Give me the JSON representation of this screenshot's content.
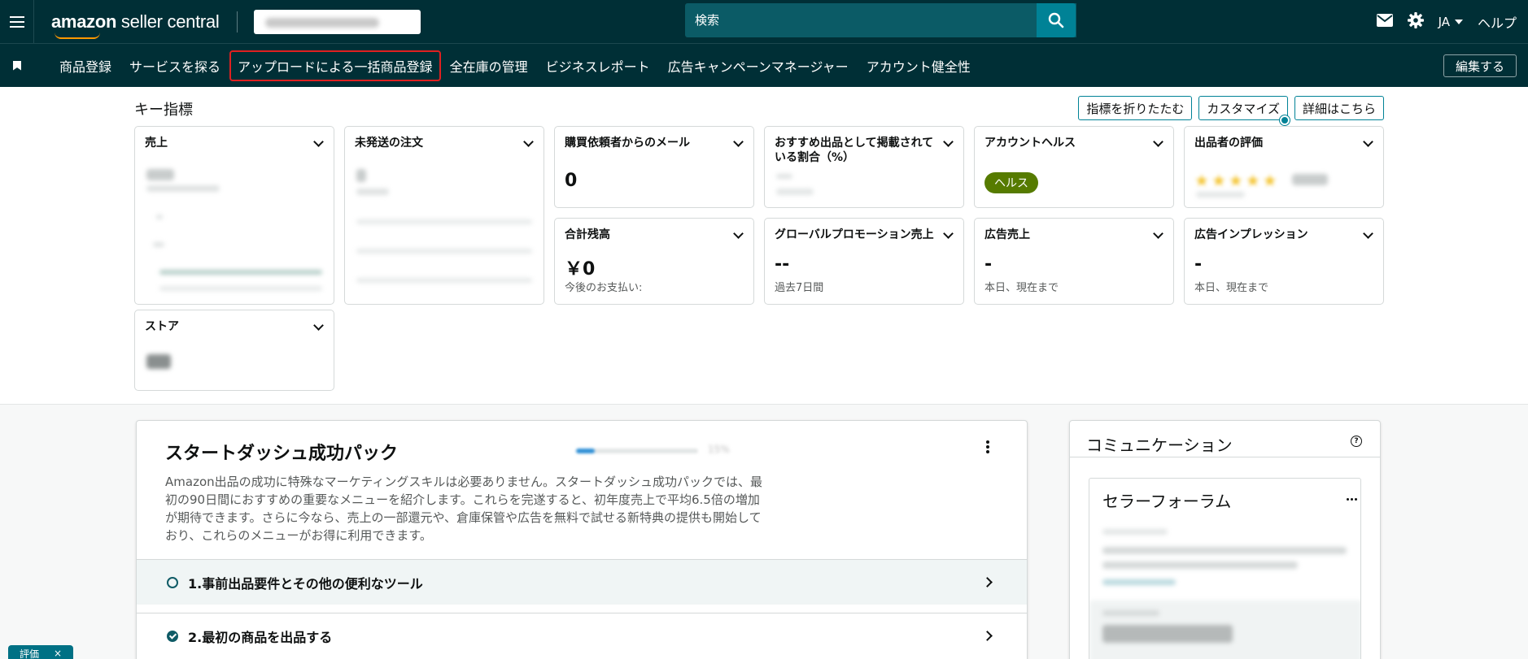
{
  "header": {
    "logo_text_bold": "amazon",
    "logo_text_rest": " seller central",
    "search_placeholder": "検索",
    "lang_label": "JA",
    "help_label": "ヘルプ"
  },
  "nav": {
    "items": [
      {
        "label": "商品登録"
      },
      {
        "label": "サービスを探る"
      },
      {
        "label": "アップロードによる一括商品登録",
        "active": true
      },
      {
        "label": "全在庫の管理"
      },
      {
        "label": "ビジネスレポート"
      },
      {
        "label": "広告キャンペーンマネージャー"
      },
      {
        "label": "アカウント健全性"
      }
    ],
    "edit_label": "編集する"
  },
  "metrics": {
    "title": "キー指標",
    "actions": {
      "collapse": "指標を折りたたむ",
      "customize": "カスタマイズ",
      "details": "詳細はこちら"
    },
    "cards": {
      "sales": {
        "title": "売上"
      },
      "unshipped": {
        "title": "未発送の注文"
      },
      "buyer_messages": {
        "title": "購買依頼者からのメール",
        "value": "0"
      },
      "featured_offer": {
        "title": "おすすめ出品として掲載されている割合（%）"
      },
      "account_health": {
        "title": "アカウントヘルス",
        "badge": "ヘルス"
      },
      "seller_rating": {
        "title": "出品者の評価"
      },
      "total_balance": {
        "title": "合計残高",
        "value": "￥0",
        "sub": "今後のお支払い:"
      },
      "global_promo": {
        "title": "グローバルプロモーション売上",
        "value": "--",
        "sub": "過去7日間"
      },
      "ad_sales": {
        "title": "広告売上",
        "value": "-",
        "sub": "本日、現在まで"
      },
      "ad_impressions": {
        "title": "広告インプレッション",
        "value": "-",
        "sub": "本日、現在まで"
      },
      "store": {
        "title": "ストア"
      }
    }
  },
  "start_pack": {
    "title": "スタートダッシュ成功パック",
    "progress_fraction": 0.15,
    "description": "Amazon出品の成功に特殊なマーケティングスキルは必要ありません。スタートダッシュ成功パックでは、最初の90日間におすすめの重要なメニューを紹介します。これらを完遂すると、初年度売上で平均6.5倍の増加が期待できます。さらに今なら、売上の一部還元や、倉庫保管や広告を無料で試せる新特典の提供も開始しており、これらのメニューがお得に利用できます。",
    "steps": [
      {
        "label": "1.事前出品要件とその他の便利なツール",
        "done": false
      },
      {
        "label": "2.最初の商品を出品する",
        "done": true
      }
    ]
  },
  "communication": {
    "title": "コミュニケーション",
    "forum_title": "セラーフォーラム"
  },
  "feedback": {
    "label": "評価",
    "close": "×"
  }
}
